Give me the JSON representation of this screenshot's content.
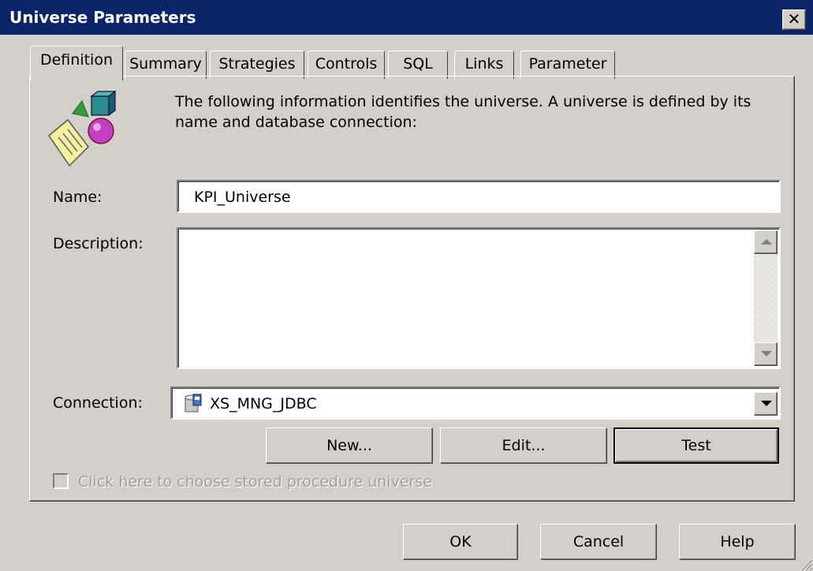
{
  "window": {
    "title": "Universe Parameters",
    "close_glyph": "✕"
  },
  "tabs": [
    {
      "label": "Definition",
      "active": true
    },
    {
      "label": "Summary"
    },
    {
      "label": "Strategies"
    },
    {
      "label": "Controls"
    },
    {
      "label": "SQL"
    },
    {
      "label": "Links"
    },
    {
      "label": "Parameter"
    }
  ],
  "definition": {
    "intro_text_line1": "The following information identifies the universe. A universe is defined by its",
    "intro_text_line2": "name and database connection:",
    "name_label": "Name:",
    "name_value": "KPI_Universe",
    "description_label": "Description:",
    "description_value": "",
    "connection_label": "Connection:",
    "connection_value": "XS_MNG_JDBC",
    "buttons": {
      "new": "New...",
      "edit": "Edit...",
      "test": "Test"
    },
    "stored_procedure_checkbox": {
      "label": "Click here to choose stored procedure universe",
      "checked": false,
      "enabled": false
    }
  },
  "dialog_buttons": {
    "ok": "OK",
    "cancel": "Cancel",
    "help": "Help"
  },
  "icons": {
    "universe_icon": "universe-icon",
    "connection_icon": "database-connection-icon"
  },
  "colors": {
    "titlebar": "#0a246a",
    "face": "#d4d0c8"
  }
}
